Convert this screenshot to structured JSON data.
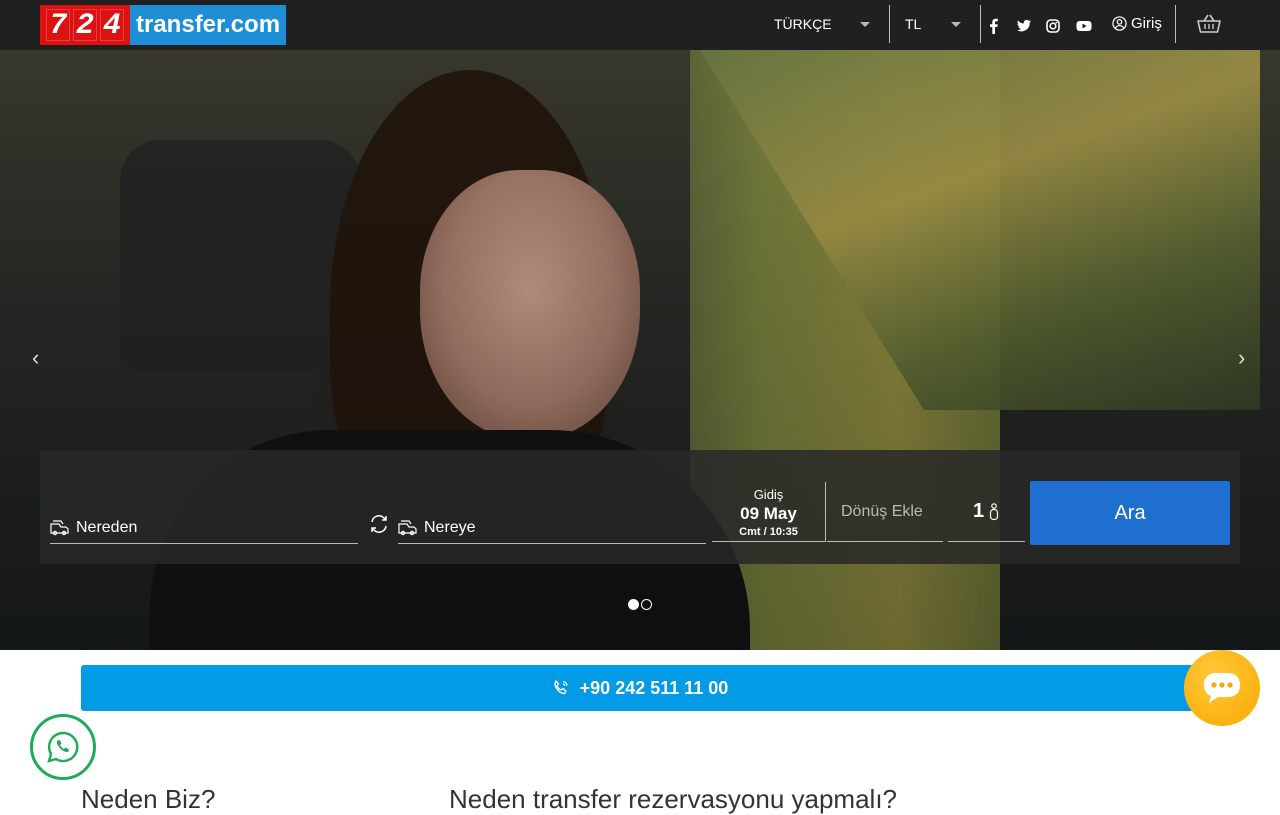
{
  "header": {
    "logo_digits": [
      "7",
      "2",
      "4"
    ],
    "logo_text": "transfer.com",
    "language": "TÜRKÇE",
    "currency": "TL",
    "login_label": "Giriş",
    "social_icons": [
      "facebook-icon",
      "twitter-icon",
      "instagram-icon",
      "youtube-icon"
    ]
  },
  "hero": {
    "prev_arrow": "‹",
    "next_arrow": "›",
    "slide_count": 2,
    "active_slide": 1
  },
  "search": {
    "from_placeholder": "Nereden",
    "to_placeholder": "Nereye",
    "departure_label": "Gidiş",
    "departure_date": "09 May",
    "departure_time": "Cmt / 10:35",
    "return_label": "Dönüş Ekle",
    "passengers": "1",
    "search_button": "Ara"
  },
  "contact": {
    "phone": "+90 242 511 11 00"
  },
  "sections": {
    "left_heading": "Neden Biz?",
    "right_heading": "Neden transfer rezervasyonu yapmalı?"
  },
  "colors": {
    "topbar": "#202020",
    "logo_red": "#dd1111",
    "logo_blue": "#1e8fd6",
    "search_button": "#1e6fd0",
    "phone_bar": "#039be5",
    "chat": "#f9a800",
    "whatsapp": "#1faa55"
  }
}
